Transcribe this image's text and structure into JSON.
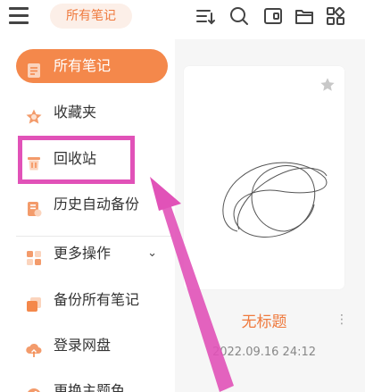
{
  "header": {
    "folder_chip": "所有笔记",
    "icons": [
      "menu-icon",
      "sort-icon",
      "search-icon",
      "toggle-view-icon",
      "folder-icon",
      "grid-icon"
    ]
  },
  "sidebar": {
    "items": [
      {
        "label": "所有笔记",
        "icon": "notes-icon",
        "active": true
      },
      {
        "label": "收藏夹",
        "icon": "favorites-star-icon"
      },
      {
        "label": "回收站",
        "icon": "trash-icon"
      },
      {
        "label": "历史自动备份",
        "icon": "history-backup-icon"
      },
      {
        "label": "更多操作",
        "icon": "more-actions-icon",
        "chevron": "⌄"
      },
      {
        "label": "备份所有笔记",
        "icon": "backup-all-icon"
      },
      {
        "label": "登录网盘",
        "icon": "cloud-login-icon"
      },
      {
        "label": "更换主题色",
        "icon": "theme-color-icon"
      }
    ]
  },
  "note_card": {
    "title": "无标题",
    "date": "2022.09.16 24:12",
    "more": "⋮"
  },
  "colors": {
    "accent": "#f4884b",
    "accent_text": "#ef7a3e",
    "annotation": "#e152b8",
    "main_bg": "#f6f6f6"
  }
}
